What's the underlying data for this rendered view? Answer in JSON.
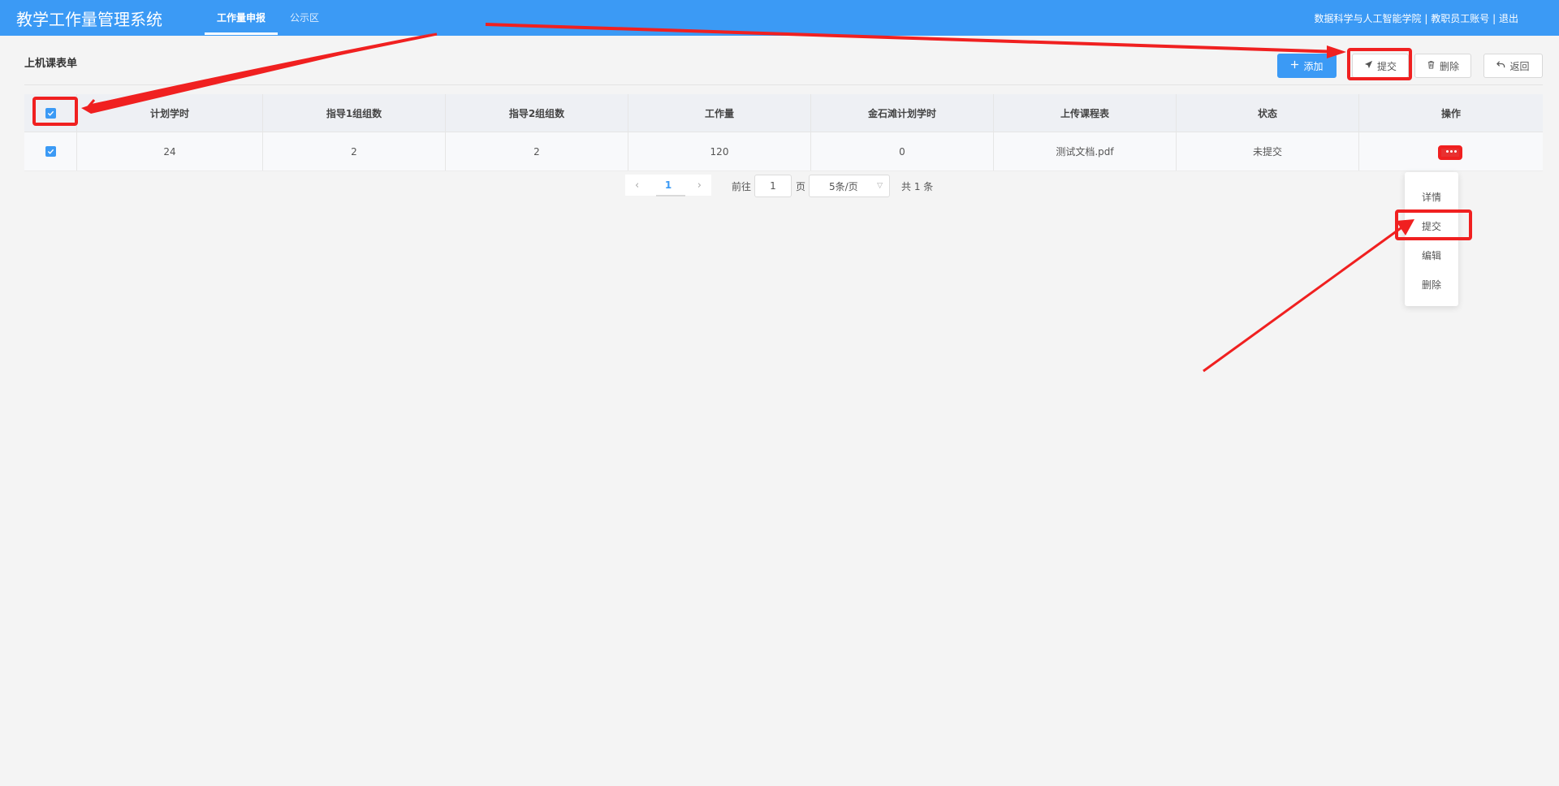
{
  "header": {
    "app_title": "教学工作量管理系统",
    "tabs": [
      {
        "label": "工作量申报",
        "active": true
      },
      {
        "label": "公示区",
        "active": false
      }
    ],
    "user": {
      "college": "数据科学与人工智能学院",
      "separator": "|",
      "account": "教职员工账号",
      "logout": "退出"
    }
  },
  "section": {
    "title": "上机课表单"
  },
  "toolbar": {
    "add_label": "添加",
    "submit_label": "提交",
    "delete_label": "删除",
    "back_label": "返回"
  },
  "table": {
    "columns": [
      "计划学时",
      "指导1组组数",
      "指导2组组数",
      "工作量",
      "金石滩计划学时",
      "上传课程表",
      "状态",
      "操作"
    ],
    "rows": [
      {
        "checked": true,
        "cells": [
          "24",
          "2",
          "2",
          "120",
          "0",
          "测试文档.pdf",
          "未提交"
        ]
      }
    ]
  },
  "pagination": {
    "current_page": "1",
    "goto_label": "前往",
    "goto_value": "1",
    "page_label": "页",
    "page_size": "5条/页",
    "total": "共 1 条"
  },
  "row_menu": {
    "items": [
      "详情",
      "提交",
      "编辑",
      "删除"
    ]
  },
  "colors": {
    "header_bg": "#3b9af5",
    "primary": "#3b9af5",
    "annotation": "#f02020"
  }
}
